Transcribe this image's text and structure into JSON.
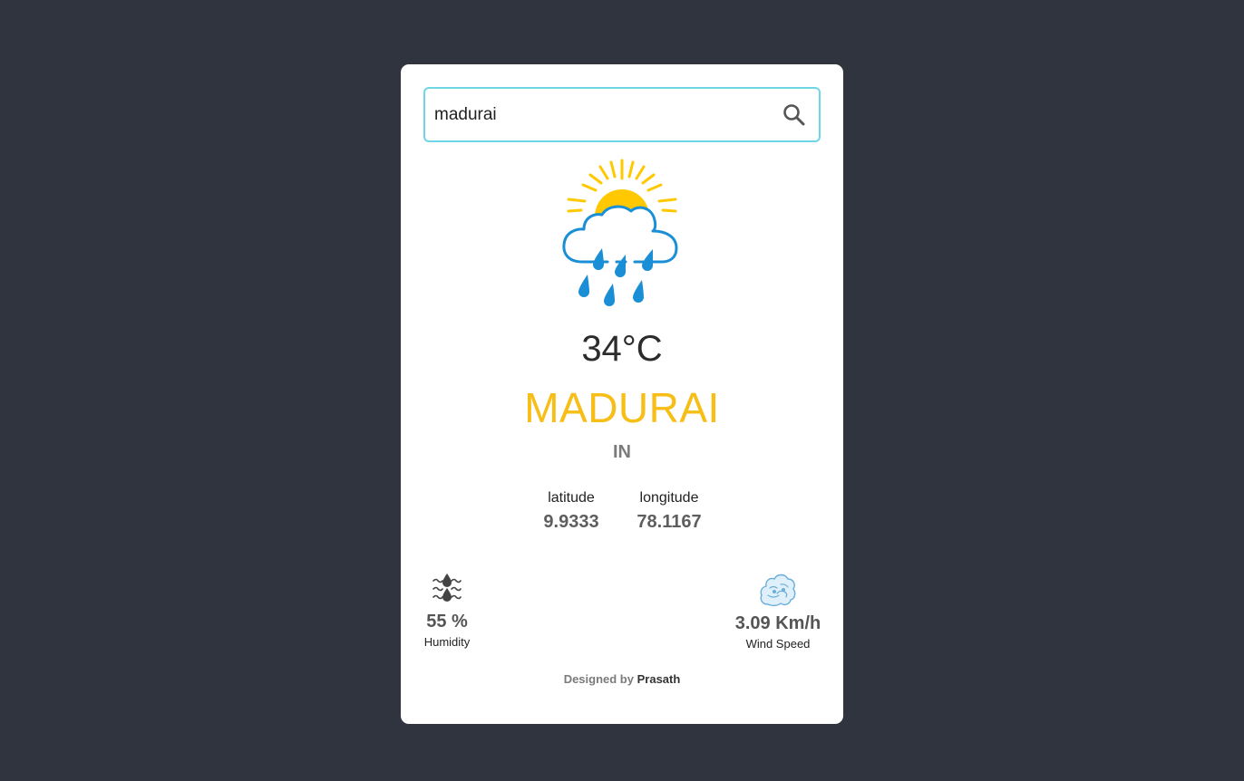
{
  "search": {
    "value": "madurai",
    "icon": "search-icon"
  },
  "weather": {
    "icon": "sun-rain-cloud-icon",
    "temperature": "34°C",
    "city": "MADURAI",
    "country": "IN"
  },
  "coordinates": {
    "latitude_label": "latitude",
    "latitude_value": "9.9333",
    "longitude_label": "longitude",
    "longitude_value": "78.1167"
  },
  "humidity": {
    "icon": "humidity-icon",
    "value": "55 %",
    "label": "Humidity"
  },
  "wind": {
    "icon": "wind-icon",
    "value": "3.09 Km/h",
    "label": "Wind Speed"
  },
  "footer": {
    "prefix": "Designed by",
    "author": "Prasath"
  },
  "colors": {
    "background": "#2f343e",
    "card": "#ffffff",
    "search_border": "#6fd6e8",
    "city": "#f7be18",
    "sun": "#ffc800",
    "rain": "#1a8fd6"
  }
}
